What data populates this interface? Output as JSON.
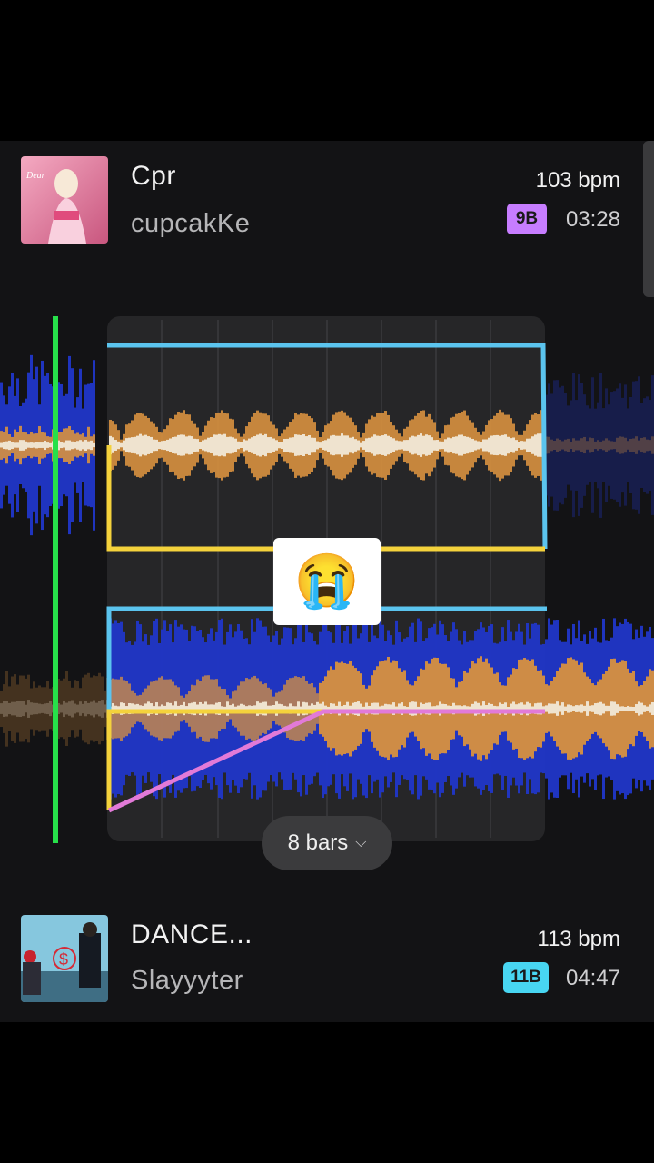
{
  "track_top": {
    "title": "Cpr",
    "artist": "cupcakKe",
    "bpm": "103 bpm",
    "key": "9B",
    "key_color": "#c77dff",
    "duration": "03:28"
  },
  "track_bottom": {
    "title": "DANCE...",
    "artist": "Slayyyter",
    "bpm": "113 bpm",
    "key": "11B",
    "key_color": "#48d6f2",
    "duration": "04:47"
  },
  "transition": {
    "reaction_emoji": "😭",
    "length_label": "8 bars",
    "length_chevron": "⌵"
  },
  "colors": {
    "playhead": "#27e04a",
    "volume_line": "#5bc4ee",
    "filter_line": "#f4d23c",
    "crossfade_line": "#e27ad8",
    "wave_blue": "#2036c8",
    "wave_orange": "#d8913f",
    "wave_cream": "#efe3cf"
  }
}
